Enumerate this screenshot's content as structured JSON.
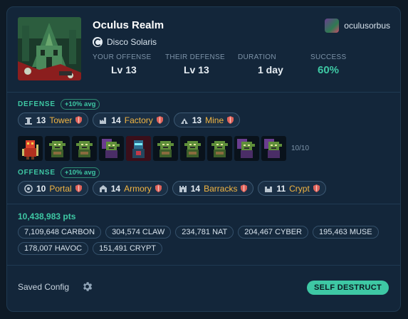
{
  "raid": {
    "title": "Oculus Realm",
    "alliance": "Disco Solaris",
    "owner": "oculusorbus"
  },
  "stats": [
    {
      "label": "YOUR OFFENSE",
      "value": "Lv 13"
    },
    {
      "label": "THEIR DEFENSE",
      "value": "Lv 13"
    },
    {
      "label": "DURATION",
      "value": "1 day"
    },
    {
      "label": "SUCCESS",
      "value": "60%"
    }
  ],
  "defense": {
    "label": "DEFENSE",
    "badge": "+10% avg",
    "buildings": [
      {
        "level": "13",
        "name": "Tower",
        "icon": "tower-icon"
      },
      {
        "level": "14",
        "name": "Factory",
        "icon": "factory-icon"
      },
      {
        "level": "13",
        "name": "Mine",
        "icon": "mine-icon"
      }
    ]
  },
  "units": {
    "count": "10/10",
    "items": [
      "red-knight",
      "goblin",
      "goblin",
      "purple-goblin",
      "cyber-soldier",
      "goblin",
      "goblin",
      "goblin",
      "purple-goblin",
      "purple-goblin"
    ]
  },
  "offense": {
    "label": "OFFENSE",
    "badge": "+10% avg",
    "buildings": [
      {
        "level": "10",
        "name": "Portal",
        "icon": "portal-icon"
      },
      {
        "level": "14",
        "name": "Armory",
        "icon": "armory-icon"
      },
      {
        "level": "14",
        "name": "Barracks",
        "icon": "barracks-icon"
      },
      {
        "level": "11",
        "name": "Crypt",
        "icon": "crypt-icon"
      }
    ]
  },
  "points": "10,438,983 pts",
  "tokens": [
    "7,109,648 CARBON",
    "304,574 CLAW",
    "234,781 NAT",
    "204,467 CYBER",
    "195,463 MUSE",
    "178,007 HAVOC",
    "151,491 CRYPT"
  ],
  "footer": {
    "saved_config": "Saved Config",
    "self_destruct": "SELF DESTRUCT"
  },
  "colors": {
    "accent": "#3ec8a4",
    "building_name": "#f2b542",
    "shield": "#e0625a"
  }
}
